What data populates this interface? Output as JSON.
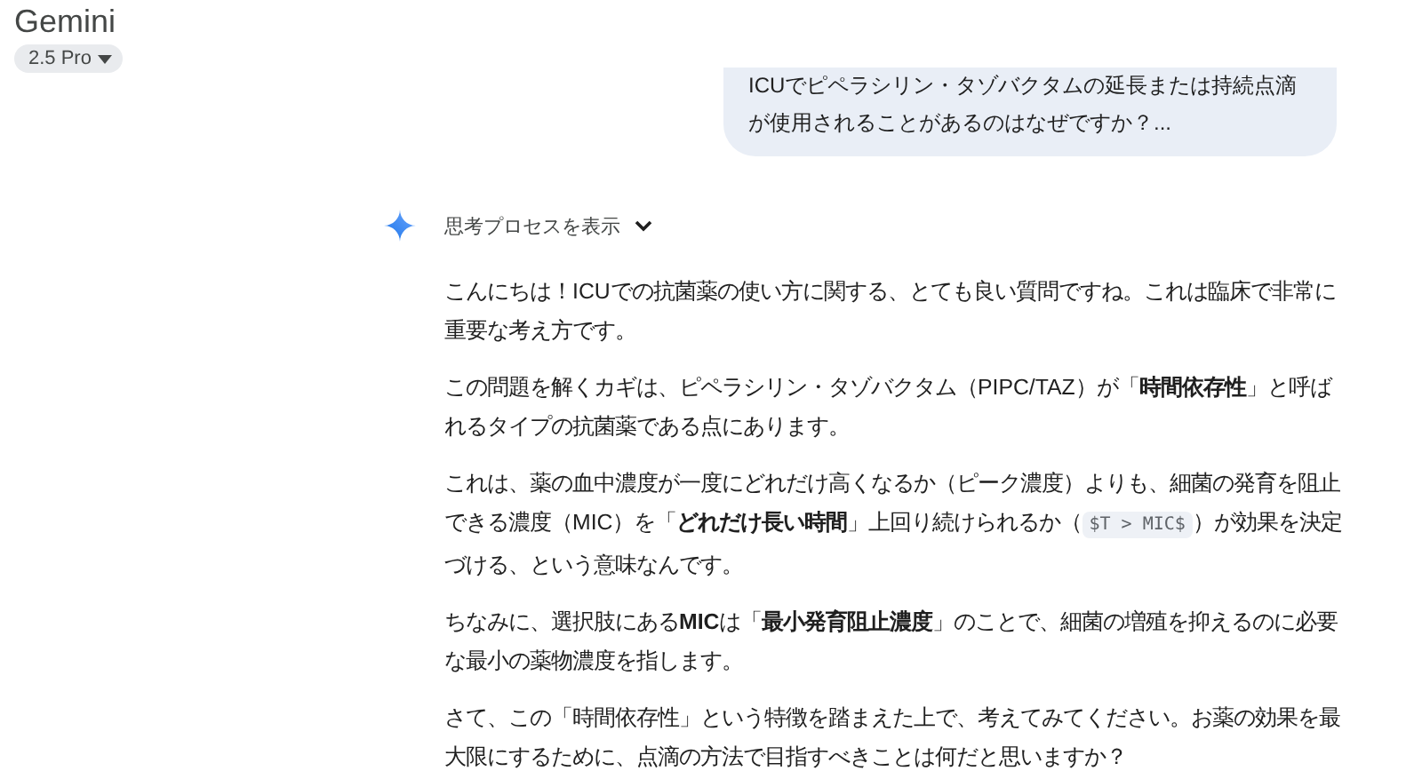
{
  "header": {
    "title": "Gemini",
    "model": "2.5 Pro"
  },
  "user_message": {
    "lines": [
      "ICUでピペラシリン・タゾバクタムの延長または持続点滴",
      "が使用されることがあるのはなぜですか？..."
    ]
  },
  "response": {
    "thoughts_toggle": {
      "label": "思考プロセスを表示",
      "expanded": false
    },
    "paragraphs": [
      {
        "parts": [
          {
            "kind": "text",
            "text": "こんにちは！ICUでの抗菌薬の使い方に関する、とても良い質問ですね。これは臨床で非常に重要な考え方です。"
          }
        ]
      },
      {
        "parts": [
          {
            "kind": "text",
            "text": "この問題を解くカギは、ピペラシリン・タゾバクタム（PIPC/TAZ）が「**時間依存性**」と呼ばれるタイプの抗菌薬である点にあります。"
          }
        ]
      },
      {
        "parts": [
          {
            "kind": "text",
            "text": "これは、薬の血中濃度が一度にどれだけ高くなるか（ピーク濃度）よりも、細菌の発育を阻止できる濃度（MIC）を「**どれだけ長い時間**」上回り続けられるか（"
          },
          {
            "kind": "code",
            "text": "$T > MIC$"
          },
          {
            "kind": "text",
            "text": "）が効果を決定づける、という意味なんです。"
          }
        ]
      },
      {
        "parts": [
          {
            "kind": "text",
            "text": "ちなみに、選択肢にある**MIC**は「**最小発育阻止濃度**」のことで、細菌の増殖を抑えるのに必要な最小の薬物濃度を指します。"
          }
        ]
      },
      {
        "parts": [
          {
            "kind": "text",
            "text": "さて、この「時間依存性」という特徴を踏まえた上で、考えてみてください。お薬の効果を最大限にするために、点滴の方法で目指すべきことは何だと思いますか？"
          }
        ]
      }
    ]
  }
}
